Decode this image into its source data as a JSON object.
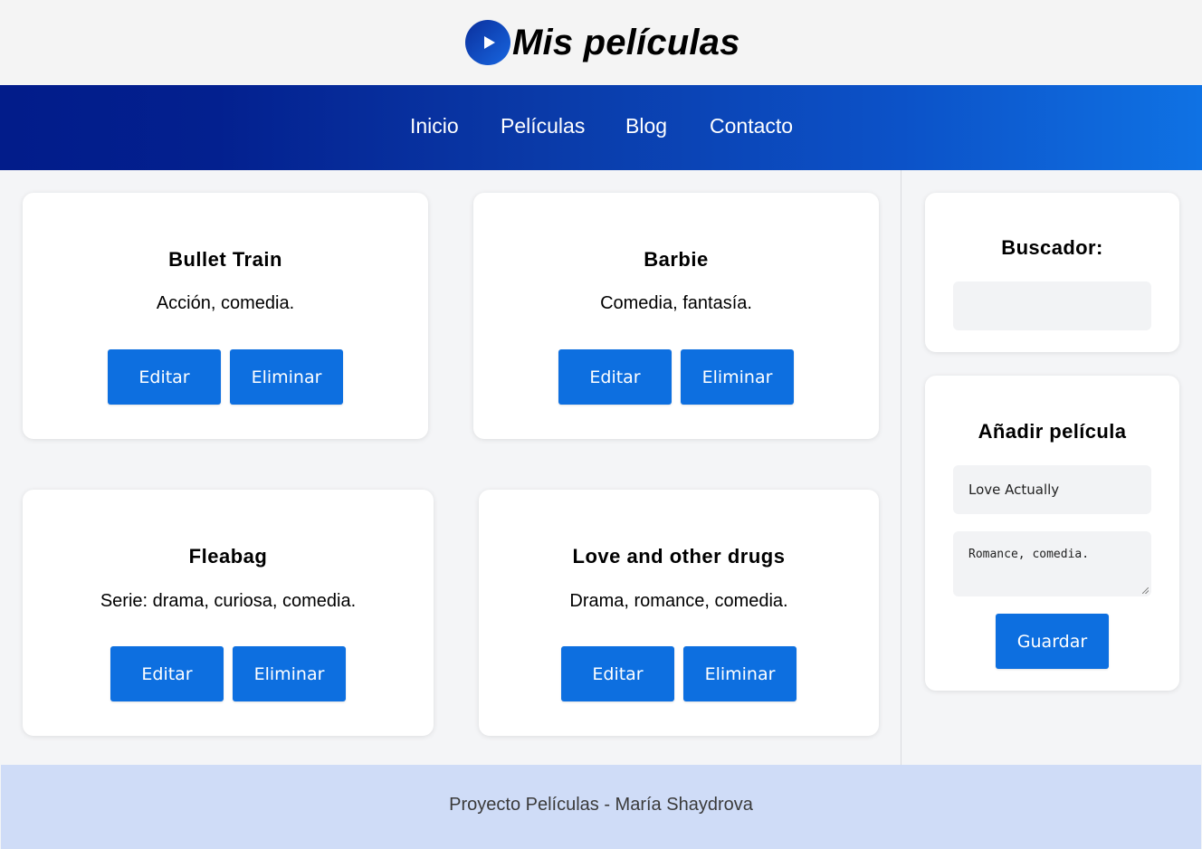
{
  "header": {
    "logo_icon": "play-icon",
    "title": "Mis películas"
  },
  "nav": {
    "items": [
      {
        "label": "Inicio"
      },
      {
        "label": "Películas"
      },
      {
        "label": "Blog"
      },
      {
        "label": "Contacto"
      }
    ]
  },
  "movies": [
    {
      "title": "Bullet Train",
      "genre": "Acción, comedia.",
      "edit_label": "Editar",
      "delete_label": "Eliminar"
    },
    {
      "title": "Barbie",
      "genre": "Comedia, fantasía.",
      "edit_label": "Editar",
      "delete_label": "Eliminar"
    },
    {
      "title": "Fleabag",
      "genre": "Serie: drama, curiosa, comedia.",
      "edit_label": "Editar",
      "delete_label": "Eliminar"
    },
    {
      "title": "Love and other drugs",
      "genre": "Drama, romance, comedia.",
      "edit_label": "Editar",
      "delete_label": "Eliminar"
    }
  ],
  "sidebar": {
    "search": {
      "title": "Buscador:",
      "value": ""
    },
    "add": {
      "title": "Añadir película",
      "title_value": "Love Actually",
      "genre_value": "Romance, comedia.",
      "save_label": "Guardar"
    }
  },
  "footer": {
    "text": "Proyecto Películas - María Shaydrova"
  },
  "colors": {
    "accent": "#0d6fe0",
    "nav_start": "#021c8a",
    "nav_end": "#0f72e4",
    "footer_bg": "#cfdcf7",
    "page_bg": "#f4f5f7"
  }
}
